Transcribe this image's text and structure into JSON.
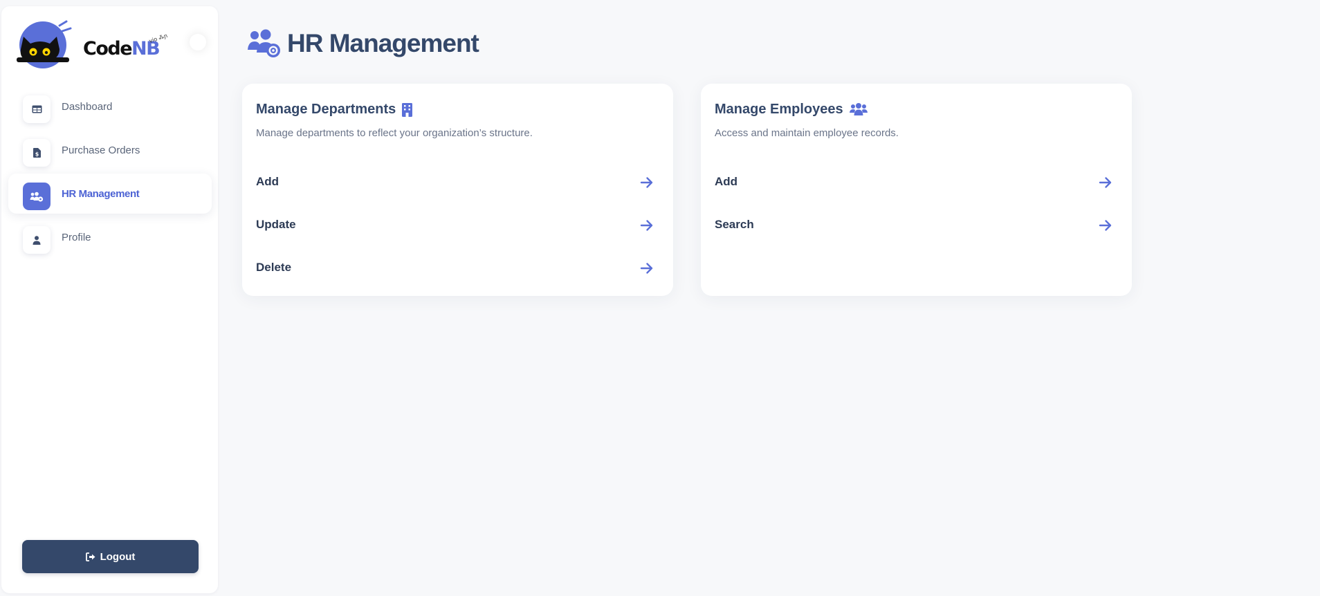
{
  "app": {
    "brand_main": "Code",
    "brand_accent": "NB",
    "brand_tag": "vio ⁂ɲ",
    "accent_color": "#5a6fd8",
    "dark_color": "#34486a"
  },
  "sidebar": {
    "items": [
      {
        "label": "Dashboard",
        "icon": "table-icon",
        "active": false
      },
      {
        "label": "Purchase Orders",
        "icon": "invoice-dollar-icon",
        "active": false
      },
      {
        "label": "HR Management",
        "icon": "users-gear-icon",
        "active": true
      },
      {
        "label": "Profile",
        "icon": "user-icon",
        "active": false
      }
    ],
    "logout_label": "Logout"
  },
  "page": {
    "title": "HR Management",
    "title_icon": "users-gear-icon"
  },
  "cards": [
    {
      "title": "Manage Departments",
      "icon": "building-icon",
      "description": "Manage departments to reflect your organization’s structure.",
      "actions": [
        {
          "label": "Add"
        },
        {
          "label": "Update"
        },
        {
          "label": "Delete"
        }
      ]
    },
    {
      "title": "Manage Employees",
      "icon": "users-icon",
      "description": "Access and maintain employee records.",
      "actions": [
        {
          "label": "Add"
        },
        {
          "label": "Search"
        }
      ]
    }
  ]
}
